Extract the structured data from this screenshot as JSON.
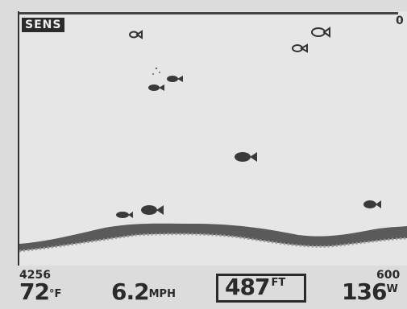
{
  "header": {
    "sens_label": "SENS",
    "depth_top": "0"
  },
  "readouts": {
    "range_left": "4256",
    "temp_value": "72",
    "temp_unit": "°F",
    "speed_value": "6.2",
    "speed_unit": "MPH",
    "depth_value": "487",
    "depth_unit": "FT",
    "range_right": "600",
    "heading_value": "136",
    "heading_unit": "W"
  },
  "colors": {
    "fish": "#3a3a3a",
    "bottom": "#555555",
    "background": "#e6e6e6"
  }
}
